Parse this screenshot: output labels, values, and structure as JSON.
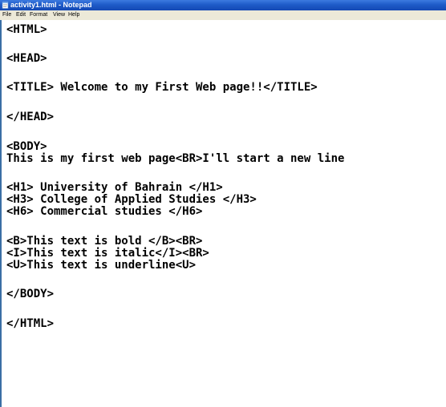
{
  "window": {
    "title": "activity1.html - Notepad"
  },
  "menu": {
    "items": [
      {
        "label": "File"
      },
      {
        "label": "Edit"
      },
      {
        "label": "Format"
      },
      {
        "label": "View"
      },
      {
        "label": "Help"
      }
    ]
  },
  "editor": {
    "lines": [
      "<HTML>",
      "",
      "<HEAD>",
      "",
      "<TITLE> Welcome to my First Web page!!</TITLE>",
      "",
      "</HEAD>",
      "",
      "<BODY>",
      "This is my first web page<BR>I'll start a new line",
      "",
      "<H1> University of Bahrain </H1>",
      "<H3> College of Applied Studies </H3>",
      "<H6> Commercial studies </H6>",
      "",
      "<B>This text is bold </B><BR>",
      "<I>This text is italic</I><BR>",
      "<U>This text is underline<U>",
      "",
      "</BODY>",
      "",
      "</HTML>"
    ]
  },
  "colors": {
    "titlebar": "#1e5bc8",
    "menubar": "#ece9d8",
    "editor_bg": "#ffffff",
    "text": "#000000"
  }
}
